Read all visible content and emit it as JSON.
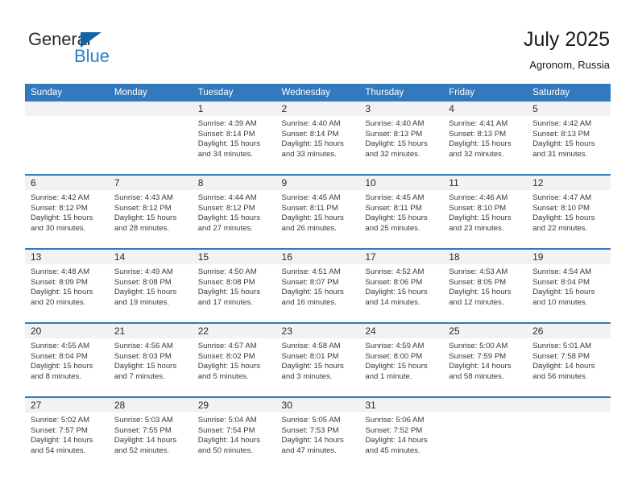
{
  "brand": {
    "name_top": "General",
    "name_bottom": "Blue",
    "accent_color": "#1464aa",
    "accent_color_light": "#2a7fc9"
  },
  "header": {
    "title": "July 2025",
    "location": "Agronom, Russia"
  },
  "theme": {
    "header_row_bg": "#3379bd",
    "daynum_row_bg": "#f2f2f2",
    "cell_bg": "#ffffff",
    "text_color": "#3a3a3a"
  },
  "calendar": {
    "weekday_headers": [
      "Sunday",
      "Monday",
      "Tuesday",
      "Wednesday",
      "Thursday",
      "Friday",
      "Saturday"
    ],
    "weeks": [
      [
        {
          "day": "",
          "sunrise": "",
          "sunset": "",
          "daylight_1": "",
          "daylight_2": ""
        },
        {
          "day": "",
          "sunrise": "",
          "sunset": "",
          "daylight_1": "",
          "daylight_2": ""
        },
        {
          "day": "1",
          "sunrise": "Sunrise: 4:39 AM",
          "sunset": "Sunset: 8:14 PM",
          "daylight_1": "Daylight: 15 hours",
          "daylight_2": "and 34 minutes."
        },
        {
          "day": "2",
          "sunrise": "Sunrise: 4:40 AM",
          "sunset": "Sunset: 8:14 PM",
          "daylight_1": "Daylight: 15 hours",
          "daylight_2": "and 33 minutes."
        },
        {
          "day": "3",
          "sunrise": "Sunrise: 4:40 AM",
          "sunset": "Sunset: 8:13 PM",
          "daylight_1": "Daylight: 15 hours",
          "daylight_2": "and 32 minutes."
        },
        {
          "day": "4",
          "sunrise": "Sunrise: 4:41 AM",
          "sunset": "Sunset: 8:13 PM",
          "daylight_1": "Daylight: 15 hours",
          "daylight_2": "and 32 minutes."
        },
        {
          "day": "5",
          "sunrise": "Sunrise: 4:42 AM",
          "sunset": "Sunset: 8:13 PM",
          "daylight_1": "Daylight: 15 hours",
          "daylight_2": "and 31 minutes."
        }
      ],
      [
        {
          "day": "6",
          "sunrise": "Sunrise: 4:42 AM",
          "sunset": "Sunset: 8:12 PM",
          "daylight_1": "Daylight: 15 hours",
          "daylight_2": "and 30 minutes."
        },
        {
          "day": "7",
          "sunrise": "Sunrise: 4:43 AM",
          "sunset": "Sunset: 8:12 PM",
          "daylight_1": "Daylight: 15 hours",
          "daylight_2": "and 28 minutes."
        },
        {
          "day": "8",
          "sunrise": "Sunrise: 4:44 AM",
          "sunset": "Sunset: 8:12 PM",
          "daylight_1": "Daylight: 15 hours",
          "daylight_2": "and 27 minutes."
        },
        {
          "day": "9",
          "sunrise": "Sunrise: 4:45 AM",
          "sunset": "Sunset: 8:11 PM",
          "daylight_1": "Daylight: 15 hours",
          "daylight_2": "and 26 minutes."
        },
        {
          "day": "10",
          "sunrise": "Sunrise: 4:45 AM",
          "sunset": "Sunset: 8:11 PM",
          "daylight_1": "Daylight: 15 hours",
          "daylight_2": "and 25 minutes."
        },
        {
          "day": "11",
          "sunrise": "Sunrise: 4:46 AM",
          "sunset": "Sunset: 8:10 PM",
          "daylight_1": "Daylight: 15 hours",
          "daylight_2": "and 23 minutes."
        },
        {
          "day": "12",
          "sunrise": "Sunrise: 4:47 AM",
          "sunset": "Sunset: 8:10 PM",
          "daylight_1": "Daylight: 15 hours",
          "daylight_2": "and 22 minutes."
        }
      ],
      [
        {
          "day": "13",
          "sunrise": "Sunrise: 4:48 AM",
          "sunset": "Sunset: 8:09 PM",
          "daylight_1": "Daylight: 15 hours",
          "daylight_2": "and 20 minutes."
        },
        {
          "day": "14",
          "sunrise": "Sunrise: 4:49 AM",
          "sunset": "Sunset: 8:08 PM",
          "daylight_1": "Daylight: 15 hours",
          "daylight_2": "and 19 minutes."
        },
        {
          "day": "15",
          "sunrise": "Sunrise: 4:50 AM",
          "sunset": "Sunset: 8:08 PM",
          "daylight_1": "Daylight: 15 hours",
          "daylight_2": "and 17 minutes."
        },
        {
          "day": "16",
          "sunrise": "Sunrise: 4:51 AM",
          "sunset": "Sunset: 8:07 PM",
          "daylight_1": "Daylight: 15 hours",
          "daylight_2": "and 16 minutes."
        },
        {
          "day": "17",
          "sunrise": "Sunrise: 4:52 AM",
          "sunset": "Sunset: 8:06 PM",
          "daylight_1": "Daylight: 15 hours",
          "daylight_2": "and 14 minutes."
        },
        {
          "day": "18",
          "sunrise": "Sunrise: 4:53 AM",
          "sunset": "Sunset: 8:05 PM",
          "daylight_1": "Daylight: 15 hours",
          "daylight_2": "and 12 minutes."
        },
        {
          "day": "19",
          "sunrise": "Sunrise: 4:54 AM",
          "sunset": "Sunset: 8:04 PM",
          "daylight_1": "Daylight: 15 hours",
          "daylight_2": "and 10 minutes."
        }
      ],
      [
        {
          "day": "20",
          "sunrise": "Sunrise: 4:55 AM",
          "sunset": "Sunset: 8:04 PM",
          "daylight_1": "Daylight: 15 hours",
          "daylight_2": "and 8 minutes."
        },
        {
          "day": "21",
          "sunrise": "Sunrise: 4:56 AM",
          "sunset": "Sunset: 8:03 PM",
          "daylight_1": "Daylight: 15 hours",
          "daylight_2": "and 7 minutes."
        },
        {
          "day": "22",
          "sunrise": "Sunrise: 4:57 AM",
          "sunset": "Sunset: 8:02 PM",
          "daylight_1": "Daylight: 15 hours",
          "daylight_2": "and 5 minutes."
        },
        {
          "day": "23",
          "sunrise": "Sunrise: 4:58 AM",
          "sunset": "Sunset: 8:01 PM",
          "daylight_1": "Daylight: 15 hours",
          "daylight_2": "and 3 minutes."
        },
        {
          "day": "24",
          "sunrise": "Sunrise: 4:59 AM",
          "sunset": "Sunset: 8:00 PM",
          "daylight_1": "Daylight: 15 hours",
          "daylight_2": "and 1 minute."
        },
        {
          "day": "25",
          "sunrise": "Sunrise: 5:00 AM",
          "sunset": "Sunset: 7:59 PM",
          "daylight_1": "Daylight: 14 hours",
          "daylight_2": "and 58 minutes."
        },
        {
          "day": "26",
          "sunrise": "Sunrise: 5:01 AM",
          "sunset": "Sunset: 7:58 PM",
          "daylight_1": "Daylight: 14 hours",
          "daylight_2": "and 56 minutes."
        }
      ],
      [
        {
          "day": "27",
          "sunrise": "Sunrise: 5:02 AM",
          "sunset": "Sunset: 7:57 PM",
          "daylight_1": "Daylight: 14 hours",
          "daylight_2": "and 54 minutes."
        },
        {
          "day": "28",
          "sunrise": "Sunrise: 5:03 AM",
          "sunset": "Sunset: 7:55 PM",
          "daylight_1": "Daylight: 14 hours",
          "daylight_2": "and 52 minutes."
        },
        {
          "day": "29",
          "sunrise": "Sunrise: 5:04 AM",
          "sunset": "Sunset: 7:54 PM",
          "daylight_1": "Daylight: 14 hours",
          "daylight_2": "and 50 minutes."
        },
        {
          "day": "30",
          "sunrise": "Sunrise: 5:05 AM",
          "sunset": "Sunset: 7:53 PM",
          "daylight_1": "Daylight: 14 hours",
          "daylight_2": "and 47 minutes."
        },
        {
          "day": "31",
          "sunrise": "Sunrise: 5:06 AM",
          "sunset": "Sunset: 7:52 PM",
          "daylight_1": "Daylight: 14 hours",
          "daylight_2": "and 45 minutes."
        },
        {
          "day": "",
          "sunrise": "",
          "sunset": "",
          "daylight_1": "",
          "daylight_2": ""
        },
        {
          "day": "",
          "sunrise": "",
          "sunset": "",
          "daylight_1": "",
          "daylight_2": ""
        }
      ]
    ]
  }
}
